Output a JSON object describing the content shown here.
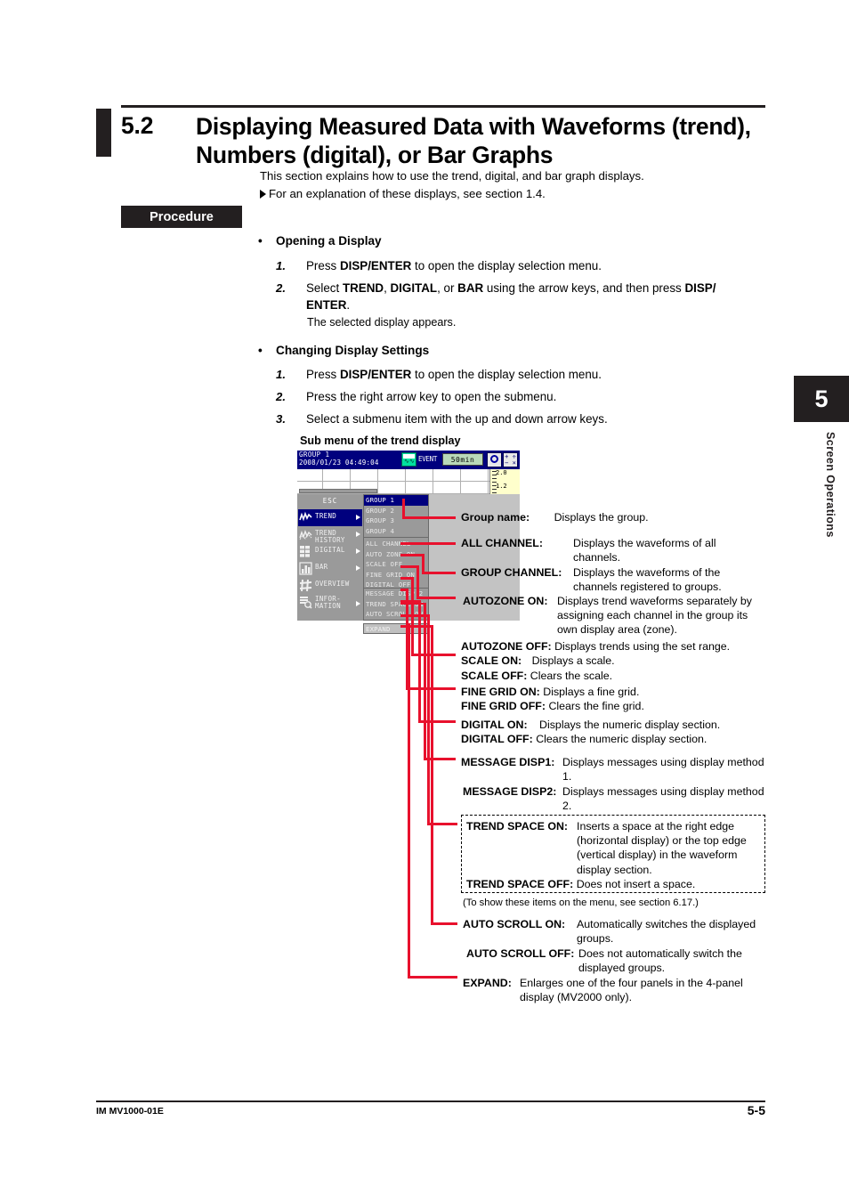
{
  "section": {
    "number": "5.2",
    "title": "Displaying Measured Data with Waveforms (trend), Numbers (digital), or Bar Graphs",
    "intro": "This section explains how to use the trend, digital, and bar graph displays.",
    "reference": "For an explanation of these displays, see section 1.4."
  },
  "procedure": {
    "tag": "Procedure",
    "groups": [
      {
        "heading": "Opening a Display",
        "steps": [
          {
            "num": "1.",
            "text": "Press DISP/ENTER to open the display selection menu."
          },
          {
            "num": "2.",
            "text": "Select TREND, DIGITAL, or BAR using the arrow keys, and then press DISP/ENTER."
          }
        ],
        "note": "The selected display appears."
      },
      {
        "heading": "Changing Display Settings",
        "steps": [
          {
            "num": "1.",
            "text": "Press DISP/ENTER to open the display selection menu."
          },
          {
            "num": "2.",
            "text": "Press the right arrow key to open the submenu."
          },
          {
            "num": "3.",
            "text": "Select a submenu item with the up and down arrow keys."
          }
        ]
      }
    ]
  },
  "lcd": {
    "caption": "Sub menu of the trend display",
    "titlebar": {
      "group_name": "GROUP 1",
      "datetime": "2008/01/23 04:49:04",
      "event_label": "EVENT",
      "interval": "50min",
      "disk_icon": "media-disk-icon",
      "config_icon": "gear-icon",
      "zoom_icon": "plus-minus-icon"
    },
    "scale": {
      "value_top": "2.0",
      "value_bottom": "1.2"
    },
    "menu": {
      "esc": "ESC",
      "items": [
        {
          "label": "TREND",
          "icon": "trend-icon",
          "arrow": true,
          "selected": true
        },
        {
          "label": "TREND\nHISTORY",
          "icon": "trend-history-icon",
          "arrow": true,
          "selected": false
        },
        {
          "label": "DIGITAL",
          "icon": "digital-icon",
          "arrow": true,
          "selected": false
        },
        {
          "label": "BAR",
          "icon": "bar-icon",
          "arrow": true,
          "selected": false
        },
        {
          "label": "OVERVIEW",
          "icon": "overview-icon",
          "arrow": false,
          "selected": false
        },
        {
          "label": "INFOR-\nMATION",
          "icon": "information-icon",
          "arrow": true,
          "selected": false
        }
      ]
    },
    "submenu": {
      "group_items": [
        {
          "label": "GROUP 1",
          "selected": true
        },
        {
          "label": "GROUP 2",
          "selected": false
        },
        {
          "label": "GROUP 3",
          "selected": false
        },
        {
          "label": "GROUP 4",
          "selected": false
        }
      ],
      "setting_items": [
        {
          "label": "ALL CHANNEL"
        },
        {
          "label": "AUTO ZONE ON"
        },
        {
          "label": "SCALE OFF"
        },
        {
          "label": "FINE GRID ON"
        },
        {
          "label": "DIGITAL OFF"
        }
      ],
      "more_icon": "chevron-down-icon",
      "extra_items": [
        {
          "label": "MESSAGE DISP 2"
        },
        {
          "label": "TREND SPACE ON"
        },
        {
          "label": "AUTO SCROLL ON"
        }
      ],
      "expand": "EXPAND"
    }
  },
  "callouts": [
    {
      "term": "Group name:",
      "desc": "Displays the group."
    },
    {
      "term": "ALL CHANNEL:",
      "desc": "Displays the waveforms of all channels."
    },
    {
      "term": "GROUP CHANNEL:",
      "desc": "Displays the waveforms of the channels registered to groups."
    },
    {
      "term": "AUTOZONE ON:",
      "desc": "Displays trend waveforms separately by assigning each channel in the group its own display area (zone)."
    },
    {
      "term": "AUTOZONE OFF:",
      "desc": "Displays trends using the set range."
    },
    {
      "term": "SCALE ON:",
      "desc": "Displays a scale."
    },
    {
      "term": "SCALE OFF:",
      "desc": "Clears the scale."
    },
    {
      "term": "FINE GRID ON:",
      "desc": "Displays a fine grid."
    },
    {
      "term": "FINE GRID OFF:",
      "desc": "Clears the fine grid."
    },
    {
      "term": "DIGITAL ON:",
      "desc": "Displays the numeric display section."
    },
    {
      "term": "DIGITAL OFF:",
      "desc": "Clears the numeric display section."
    },
    {
      "term": "MESSAGE DISP1:",
      "desc": "Displays messages using display method 1."
    },
    {
      "term": "MESSAGE DISP2:",
      "desc": "Displays messages using display method 2."
    },
    {
      "term": "TREND SPACE ON:",
      "desc": "Inserts a space at the right edge (horizontal display) or the top edge (vertical display) in the waveform display section."
    },
    {
      "term": "TREND SPACE OFF:",
      "desc": "Does not insert a space."
    },
    {
      "term": "AUTO SCROLL ON:",
      "desc": "Automatically switches the displayed groups."
    },
    {
      "term": "AUTO SCROLL OFF:",
      "desc": "Does not automatically switch the displayed groups."
    },
    {
      "term": "EXPAND:",
      "desc": "Enlarges one of the four panels in the 4-panel display (MV2000 only)."
    }
  ],
  "note_6_17": "(To show these items on the menu, see section 6.17.)",
  "side_tab": {
    "number": "5",
    "label": "Screen Operations"
  },
  "footer": {
    "left": "IM MV1000-01E",
    "right": "5-5"
  },
  "colors": {
    "accent_red": "#e8112d",
    "ink": "#231f20",
    "lcd_blue": "#00007e",
    "lcd_gray": "#9a9a9a"
  }
}
